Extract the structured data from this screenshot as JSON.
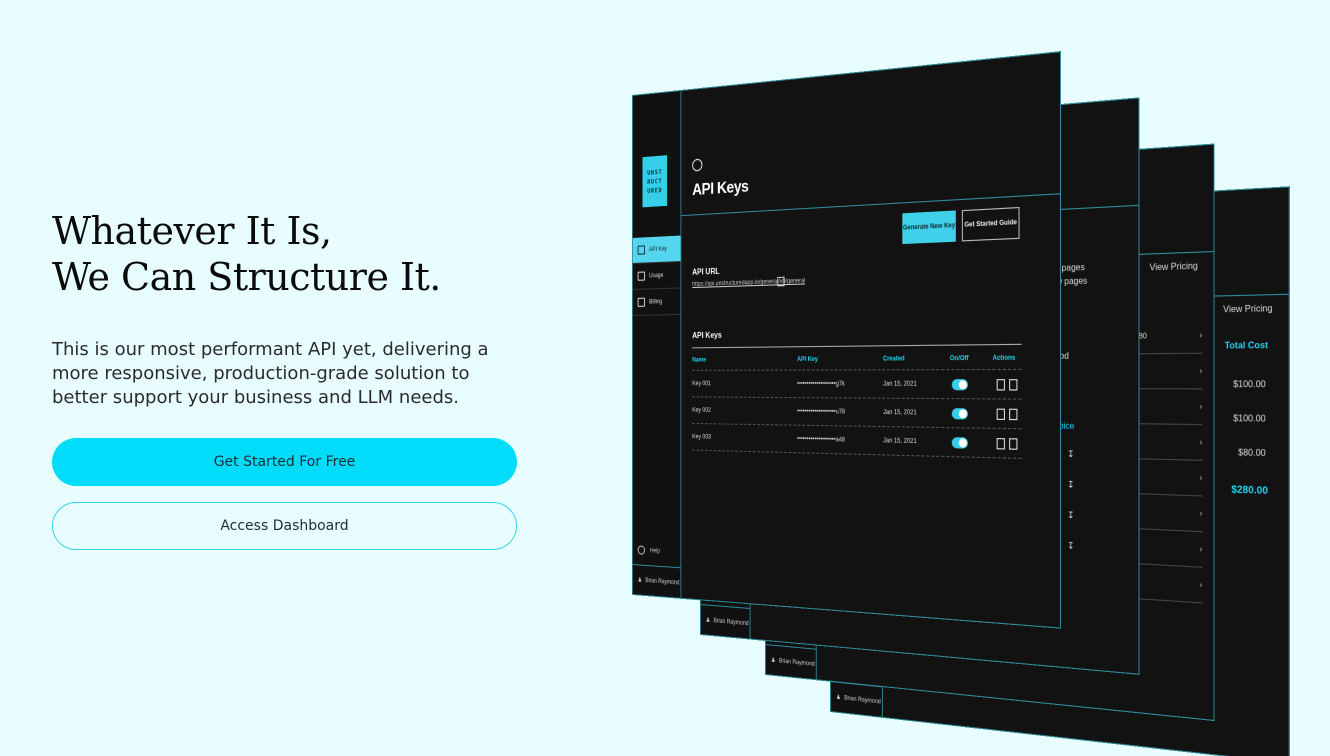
{
  "hero": {
    "headline_line1": "Whatever It Is,",
    "headline_line2": "We Can Structure It.",
    "description": "This is our most performant API yet, delivering a more responsive, production-grade solution to better support your business and LLM needs.",
    "primary_cta": "Get Started For Free",
    "secondary_cta": "Access Dashboard"
  },
  "mockup": {
    "logo_lines": [
      "UNST",
      "RUCT",
      "URED"
    ],
    "nav": [
      {
        "label": "API Key",
        "icon": "key-icon",
        "active": true
      },
      {
        "label": "Usage",
        "icon": "usage-icon",
        "active": false
      },
      {
        "label": "Billing",
        "icon": "billing-icon",
        "active": false
      }
    ],
    "help_label": "Help",
    "user_name": "Brian Raymond",
    "page_title": "API Keys",
    "generate_button": "Generate New Key",
    "guide_button": "Get Started Guide",
    "api_url_label": "API URL",
    "api_url": "https://api.unstructuredapp.io/general/v0/general",
    "keys_section_label": "API Keys",
    "columns": [
      "Name",
      "API Key",
      "Created",
      "On/Off",
      "Actions"
    ],
    "keys": [
      {
        "name": "Key 001",
        "key": "••••••••••••••••••••g7k",
        "created": "Jan 15, 2021"
      },
      {
        "name": "Key 002",
        "key": "••••••••••••••••••••u78",
        "created": "Jan 15, 2021"
      },
      {
        "name": "Key 003",
        "key": "••••••••••••••••••••a48",
        "created": "Jan 15, 2021"
      }
    ],
    "billing": {
      "view_pricing": "View Pricing",
      "total_cost_label": "Total Cost",
      "costs": [
        "$100.00",
        "$100.00",
        "$80.00"
      ],
      "total": "$280.00"
    },
    "fragments": {
      "pages_a": "0 pages",
      "pages_b": "00 pages",
      "st": "st",
      "method": "thod",
      "invoice": "voice",
      "row_value": "80"
    }
  },
  "colors": {
    "accent": "#00dcfa",
    "background": "#e8fdff",
    "panel": "#121212"
  }
}
